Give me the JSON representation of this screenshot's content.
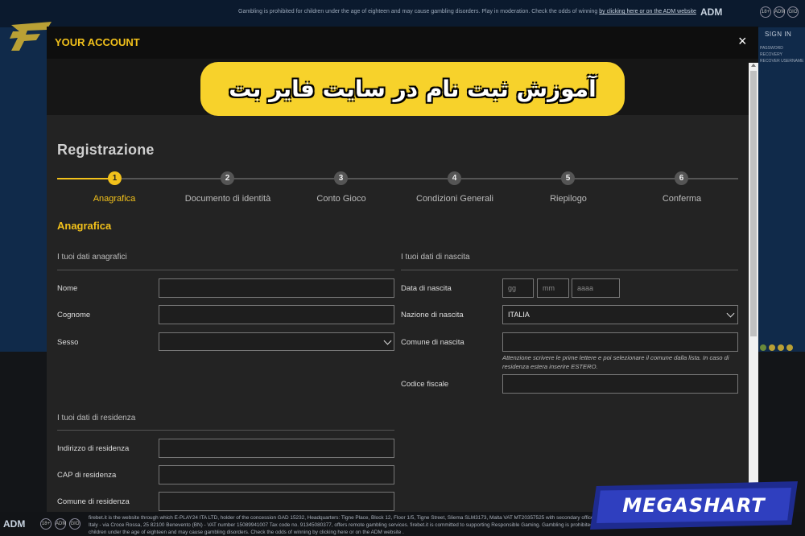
{
  "site": {
    "notice_prefix": "Gambling is prohibited for children under the age of eighteen and may cause gambling disorders. Play in moderation. Check the odds of winning",
    "notice_link": "by clicking here or on the ADM website",
    "adm": "ADM",
    "badges": [
      "18+",
      "ADM",
      "GIO"
    ],
    "sign_in": "SIGN IN",
    "recover_lines": [
      "PASSWORD RECOVERY",
      "RECOVER USERNAME"
    ]
  },
  "modal": {
    "title": "YOUR ACCOUNT",
    "close": "×",
    "banner_text": "آموزش ثبت نام در سایت فایر بت",
    "registration_title": "Registrazione",
    "steps": [
      {
        "num": "1",
        "label": "Anagrafica"
      },
      {
        "num": "2",
        "label": "Documento di identità"
      },
      {
        "num": "3",
        "label": "Conto Gioco"
      },
      {
        "num": "4",
        "label": "Condizioni Generali"
      },
      {
        "num": "5",
        "label": "Riepilogo"
      },
      {
        "num": "6",
        "label": "Conferma"
      }
    ],
    "active_step": 1,
    "section_title": "Anagrafica",
    "personal": {
      "title": "I tuoi dati anagrafici",
      "nome": "Nome",
      "cognome": "Cognome",
      "sesso": "Sesso"
    },
    "birth": {
      "title": "I tuoi dati di nascita",
      "data_label": "Data di nascita",
      "gg": "gg",
      "mm": "mm",
      "aaaa": "aaaa",
      "nazione_label": "Nazione di nascita",
      "nazione_value": "ITALIA",
      "comune_label": "Comune di nascita",
      "hint": "Attenzione scrivere le prime lettere e poi selezionare il comune dalla lista. In caso di residenza estera inserire ESTERO.",
      "codice_label": "Codice fiscale"
    },
    "residence": {
      "title": "I tuoi dati di residenza",
      "indirizzo": "Indirizzo di residenza",
      "cap": "CAP di residenza",
      "comune": "Comune di residenza"
    }
  },
  "footer": {
    "adm": "ADM",
    "badges": [
      "18+",
      "ADM",
      "GIO"
    ],
    "text": "firebet.it is the website through which E-PLAY24 ITA LTD, holder of the concession GAD 15232, Headquarters: Tigne Place, Block 12, Floor 1/5, Tigne Street, Sliema SLM3173, Malta VAT MT20357525 with secondary office in Italy - via Croce Rossa, 25 82100 Benevento (BN) - VAT number 15089941007 Tax code no. 91345080377, offers remote gambling services. firebet.it is committed to supporting Responsible Gaming. Gambling is prohibited for children under the age of eighteen and may cause gambling disorders. Check the odds of winning by clicking here or on the ADM website ."
  },
  "watermark": "MEGASHART",
  "colors": {
    "accent": "#f2c11b",
    "modal_bg": "#232323",
    "site_bg": "#102a4a",
    "watermark_blue": "#2f3fbf"
  }
}
